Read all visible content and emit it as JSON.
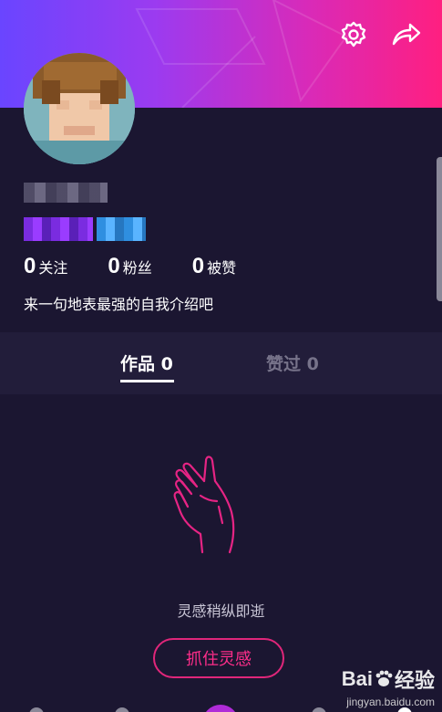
{
  "profile": {
    "followers_stats": [
      {
        "num": "0",
        "label": "关注"
      },
      {
        "num": "0",
        "label": "粉丝"
      },
      {
        "num": "0",
        "label": "被赞"
      }
    ],
    "bio": "来一句地表最强的自我介绍吧"
  },
  "header": {
    "settings_icon": "gear-icon",
    "share_icon": "share-arrow-icon"
  },
  "tabs": {
    "works": "作品 0",
    "liked": "赞过 0"
  },
  "empty_state": {
    "message": "灵感稍纵即逝",
    "cta_label": "抓住灵感"
  },
  "watermark": {
    "brand": "Bai",
    "brand_cn": "经验",
    "url": "jingyan.baidu.com"
  },
  "colors": {
    "accent": "#ff2d8a",
    "banner_start": "#6a45ff",
    "banner_end": "#ff1f80",
    "background": "#1b1631"
  }
}
